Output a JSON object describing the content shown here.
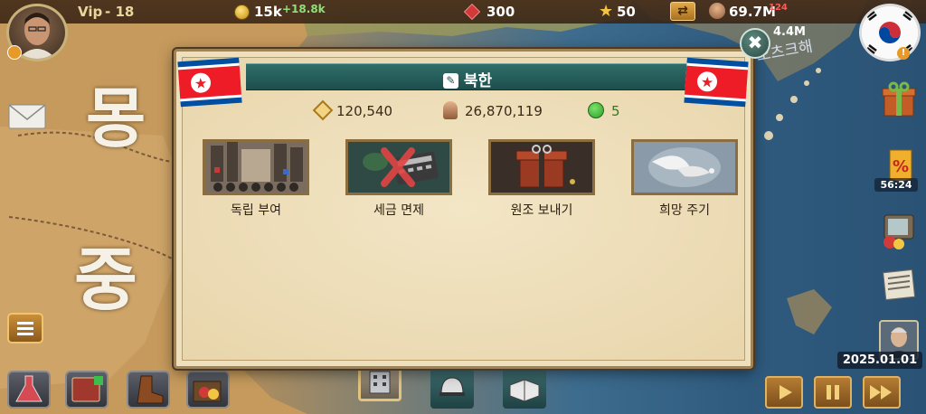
{
  "map": {
    "label_mongolia": "몽",
    "label_china": "중",
    "label_okhotsk": "오츠크해"
  },
  "hud": {
    "vip_label": "Vip",
    "vip_level": "- 18",
    "gold_value": "15k",
    "gold_income": "+18.8k",
    "gems_value": "300",
    "stars_value": "50",
    "population_value": "69.7M",
    "population_small": "124",
    "side_value": "4.4M"
  },
  "sidebar": {
    "timer": "56:24",
    "date": "2025.01.01"
  },
  "modal": {
    "title": "북한",
    "stats": {
      "money": "120,540",
      "population": "26,870,119",
      "happiness": "5"
    },
    "actions": [
      {
        "label": "독립 부여"
      },
      {
        "label": "세금 면제"
      },
      {
        "label": "원조 보내기"
      },
      {
        "label": "희망 주기"
      }
    ],
    "close_icon": "✖"
  },
  "colors": {
    "title_bar": "#1d4e4c",
    "panel": "#efe0bd",
    "gold": "#e0b260"
  }
}
